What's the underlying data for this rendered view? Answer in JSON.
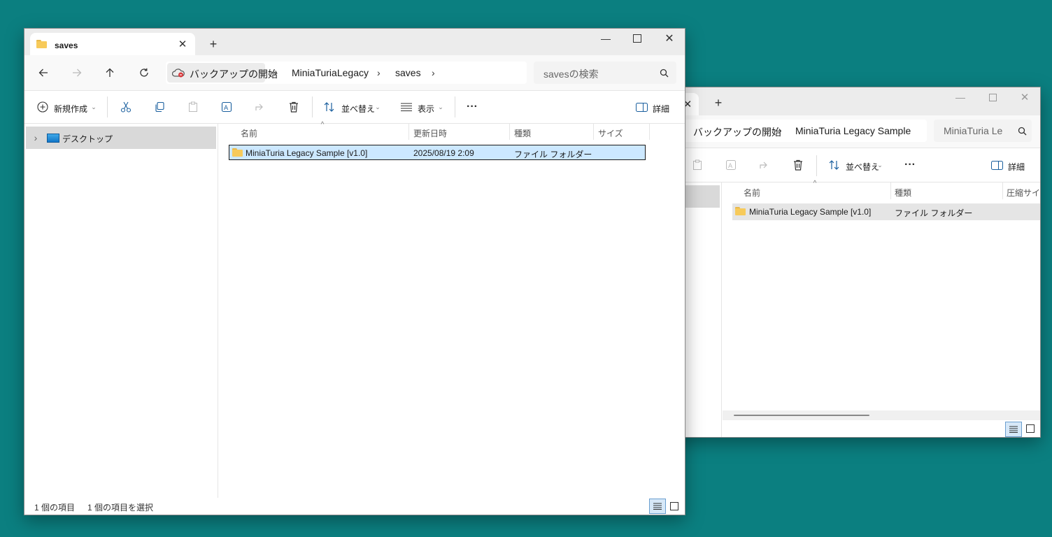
{
  "background_color": "#0b7f80",
  "back_window": {
    "address": {
      "crumbs": [
        "バックアップの開始",
        "MiniaTuria Legacy Sample"
      ]
    },
    "search_placeholder": "MiniaTuria Le",
    "toolbar": {
      "sort_label": "並べ替え",
      "details_label": "詳細"
    },
    "columns": [
      "名前",
      "種類",
      "圧縮サイズ"
    ],
    "rows": [
      {
        "name": "MiniaTuria Legacy Sample [v1.0]",
        "type": "ファイル フォルダー"
      }
    ]
  },
  "front_window": {
    "tab_title": "saves",
    "address": {
      "crumbs": [
        "バックアップの開始",
        "MiniaTuriaLegacy",
        "saves"
      ]
    },
    "search_placeholder": "savesの検索",
    "toolbar": {
      "new_label": "新規作成",
      "sort_label": "並べ替え",
      "view_label": "表示",
      "details_label": "詳細"
    },
    "sidebar": {
      "items": [
        {
          "label": "デスクトップ"
        }
      ]
    },
    "columns": [
      "名前",
      "更新日時",
      "種類",
      "サイズ"
    ],
    "rows": [
      {
        "name": "MiniaTuria Legacy Sample [v1.0]",
        "modified": "2025/08/19 2:09",
        "type": "ファイル フォルダー",
        "size": "",
        "selected": true
      }
    ],
    "status": {
      "count": "1 個の項目",
      "selected": "1 個の項目を選択"
    },
    "selection_color": "#cce8ff"
  },
  "icons": {
    "close": "close-icon",
    "minimize": "minimize-icon",
    "maximize": "maximize-icon",
    "back": "arrow-left-icon",
    "forward": "arrow-right-icon",
    "up": "arrow-up-icon",
    "refresh": "refresh-icon",
    "cut": "cut-icon",
    "copy": "copy-icon",
    "paste": "paste-icon",
    "rename": "rename-icon",
    "share": "share-icon",
    "delete": "delete-icon",
    "more": "more-icon",
    "search": "search-icon"
  }
}
